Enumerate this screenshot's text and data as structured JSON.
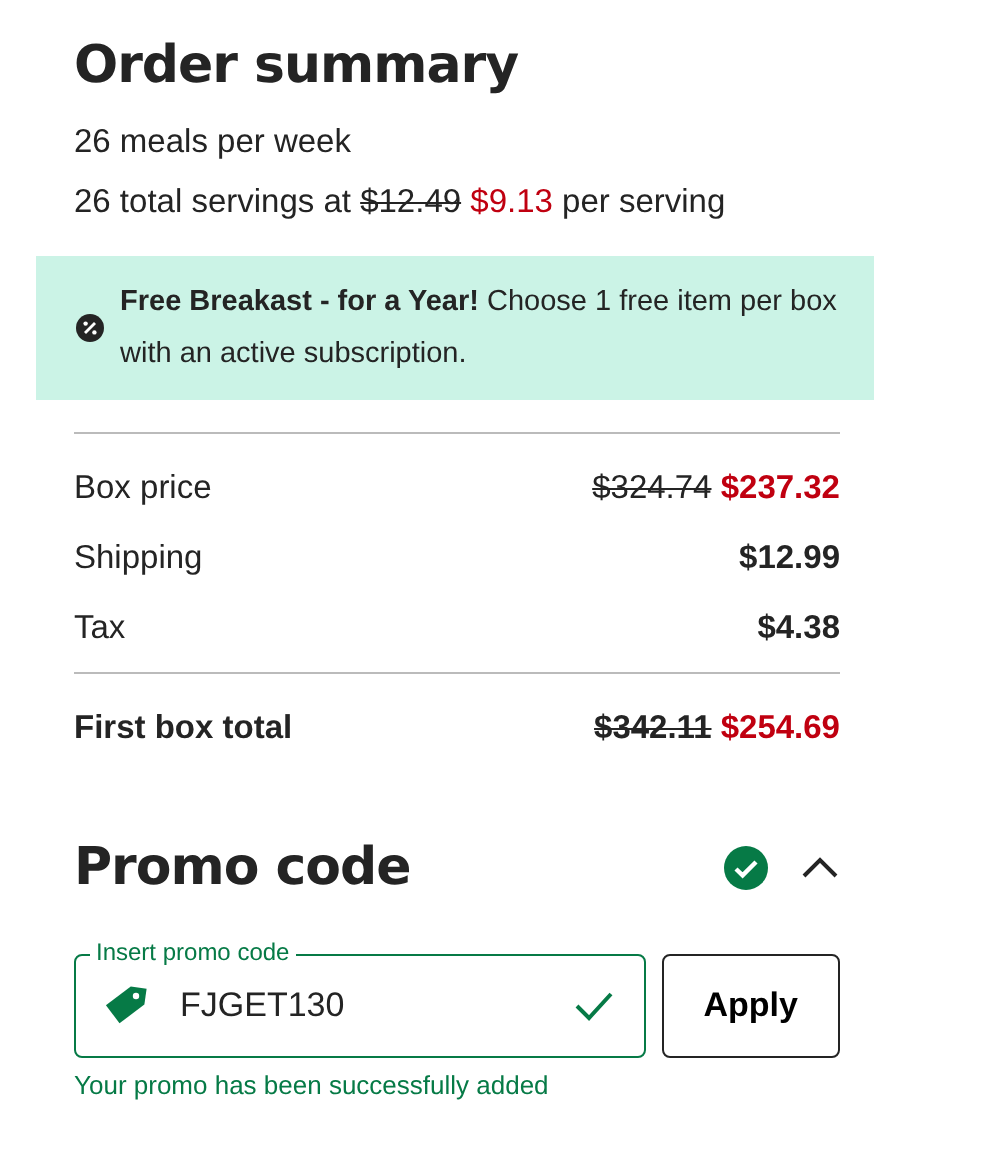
{
  "title": "Order summary",
  "meals": "26 meals per week",
  "servings": {
    "before": "26 total servings at",
    "old_price": "$12.49",
    "new_price": "$9.13",
    "after": "per serving"
  },
  "promo_banner": {
    "text": "**Free Breakast - for a Year!** Choose 1 free item per box with an active subscription."
  },
  "lines": [
    {
      "label": "Box price",
      "old_price": "$324.74",
      "price": "$237.32",
      "kind": "discounted"
    },
    {
      "label": "Shipping",
      "price": "$12.99",
      "kind": "plain"
    },
    {
      "label": "Tax",
      "price": "$4.38",
      "kind": "plain"
    },
    {
      "label": "First box total",
      "old_price": "$342.11",
      "price": "$254.69",
      "kind": "total"
    }
  ],
  "promo": {
    "title": "Promo code",
    "applied": true,
    "expanded": true,
    "field_label": "Insert promo code",
    "value": "FJGET130",
    "button": "Apply",
    "message": "Your promo has been successfully added"
  }
}
